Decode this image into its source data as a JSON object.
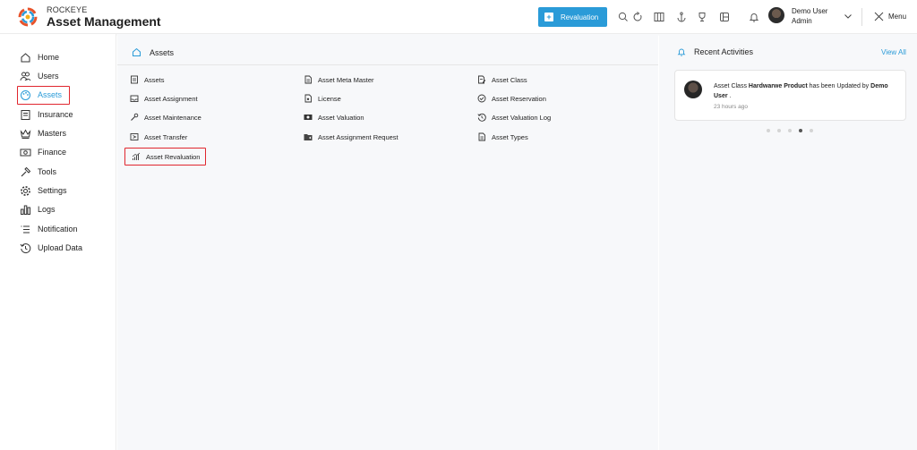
{
  "header": {
    "brand_small": "ROCKEYE",
    "brand_big": "Asset Management",
    "revaluation_button": "Revaluation",
    "user_name": "Demo User",
    "user_role": "Admin",
    "menu_label": "Menu"
  },
  "sidebar": {
    "items": [
      {
        "label": "Home",
        "icon": "home-icon"
      },
      {
        "label": "Users",
        "icon": "users-icon"
      },
      {
        "label": "Assets",
        "icon": "palette-icon",
        "active": true
      },
      {
        "label": "Insurance",
        "icon": "insurance-icon"
      },
      {
        "label": "Masters",
        "icon": "crown-icon"
      },
      {
        "label": "Finance",
        "icon": "finance-icon"
      },
      {
        "label": "Tools",
        "icon": "tools-icon"
      },
      {
        "label": "Settings",
        "icon": "gear-icon"
      },
      {
        "label": "Logs",
        "icon": "logs-icon"
      },
      {
        "label": "Notification",
        "icon": "notification-list-icon"
      },
      {
        "label": "Upload Data",
        "icon": "history-icon"
      }
    ]
  },
  "main": {
    "title": "Assets",
    "links": [
      {
        "label": "Assets",
        "icon": "document-icon"
      },
      {
        "label": "Asset Meta Master",
        "icon": "document-icon"
      },
      {
        "label": "Asset Class",
        "icon": "document-edit-icon"
      },
      {
        "label": "Asset Assignment",
        "icon": "inbox-icon"
      },
      {
        "label": "License",
        "icon": "license-icon"
      },
      {
        "label": "Asset Reservation",
        "icon": "check-circle-icon"
      },
      {
        "label": "Asset Maintenance",
        "icon": "wrench-icon"
      },
      {
        "label": "Asset Valuation",
        "icon": "money-icon"
      },
      {
        "label": "Asset Valuation Log",
        "icon": "history-icon"
      },
      {
        "label": "Asset Transfer",
        "icon": "transfer-icon"
      },
      {
        "label": "Asset Assignment Request",
        "icon": "folder-icon"
      },
      {
        "label": "Asset Types",
        "icon": "document-icon"
      },
      {
        "label": "Asset Revaluation",
        "icon": "bar-chart-icon"
      }
    ]
  },
  "activities": {
    "title": "Recent Activities",
    "view_all": "View All",
    "item": {
      "prefix": "Asset Class",
      "product": "Hardwarwe Product",
      "middle": "has been Updated by",
      "user": "Demo User",
      "suffix": ".",
      "time": "23 hours ago"
    },
    "dots_total": 5,
    "dot_active": 4
  },
  "colors": {
    "accent": "#2a9bd8",
    "highlight": "#e0262e"
  }
}
